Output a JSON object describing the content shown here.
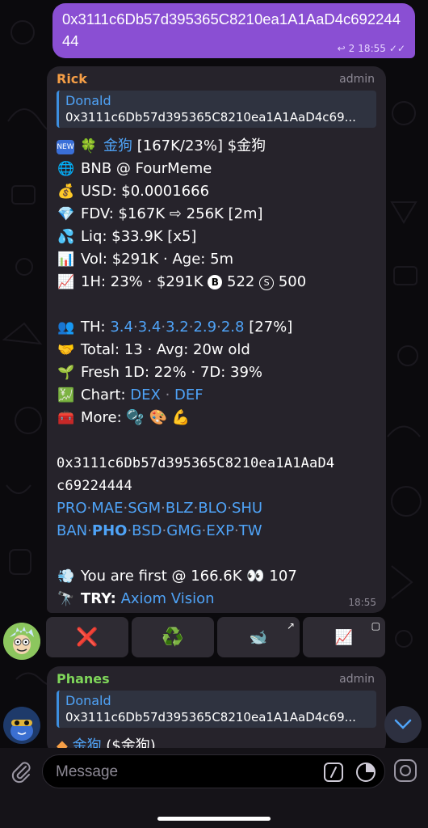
{
  "outgoing": {
    "text": "0x3111c6Db57d395365C8210ea1A1AaD4c69224444",
    "replies": "2",
    "time": "18:55"
  },
  "message1": {
    "sender": "Rick",
    "sender_color": "#f59e46",
    "role": "admin",
    "reply_name": "Donald",
    "reply_text": "0x3111c6Db57d395365C8210ea1A1AaD4c69...",
    "token_name": "金狗",
    "headline_stats": "[167K/23%] $金狗",
    "chain": "BNB @ FourMeme",
    "usd": "USD: $0.0001666",
    "fdv": "FDV: $167K ⇨ 256K [2m]",
    "liq": "Liq: $33.9K [x5]",
    "vol": "Vol: $291K · Age: 5m",
    "hour_a": "1H: 23% · $291K ",
    "buys": "522",
    "sells": "500",
    "th_label": "TH:",
    "th_values": [
      "3.4",
      "3.4",
      "3.2",
      "2.9",
      "2.8"
    ],
    "th_total": "[27%]",
    "total": "Total: 13 · Avg: 20w old",
    "fresh": "Fresh 1D: 22% · 7D: 39%",
    "chart_label": "Chart:",
    "chart_links": [
      "DEX",
      "DEF"
    ],
    "more_label": "More:",
    "address_line1": "0x3111c6Db57d395365C8210ea1A1AaD4",
    "address_line2": "c69224444",
    "links_row1": [
      "PRO",
      "MAE",
      "SGM",
      "BLZ",
      "BLO",
      "SHU"
    ],
    "links_row2": [
      "BAN",
      "PHO",
      "BSD",
      "GMG",
      "EXP",
      "TW"
    ],
    "first_text": "You are first @ 166.6K ",
    "first_count": "107",
    "try_label": "TRY:",
    "try_link": "Axiom Vision",
    "time": "18:55"
  },
  "keyboard": {
    "buttons": [
      "❌",
      "♻️",
      "🐋",
      "📈"
    ]
  },
  "message2": {
    "sender": "Phanes",
    "sender_color": "#7fd65a",
    "role": "admin",
    "reply_name": "Donald",
    "reply_text": "0x3111c6Db57d395365C8210ea1A1AaD4c69...",
    "peek_name": "金狗",
    "peek_rest": " ($金狗)"
  },
  "composer": {
    "placeholder": "Message"
  }
}
